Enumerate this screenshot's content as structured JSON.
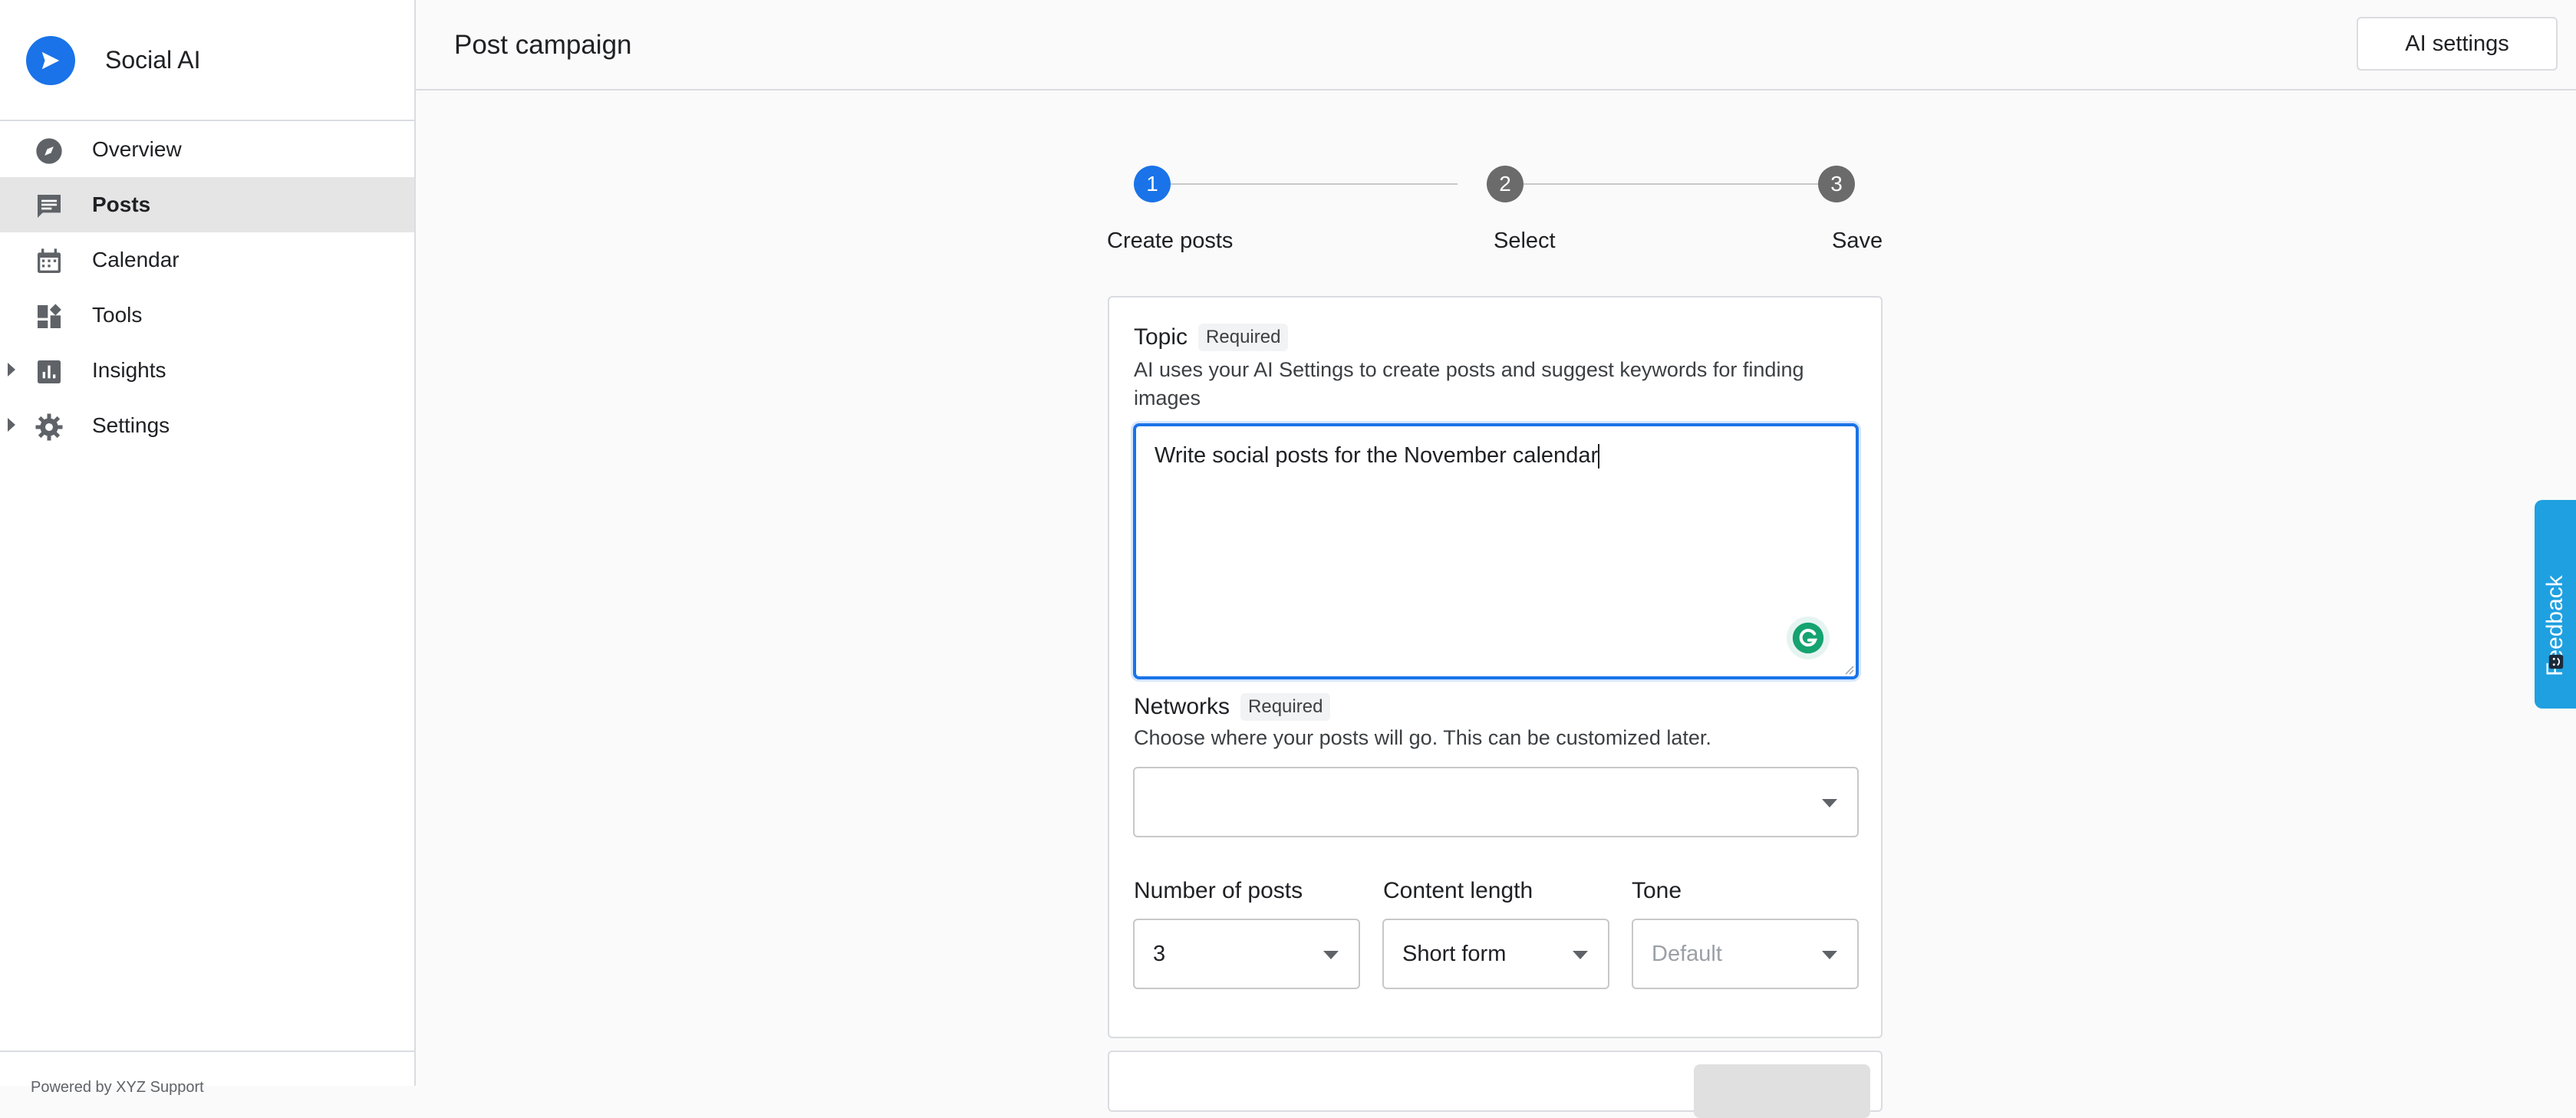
{
  "app": {
    "name": "Social AI",
    "brand_color": "#1a73e8"
  },
  "sidebar": {
    "items": [
      {
        "label": "Overview",
        "icon": "compass-icon",
        "active": false,
        "expandable": false
      },
      {
        "label": "Posts",
        "icon": "chat-icon",
        "active": true,
        "expandable": false
      },
      {
        "label": "Calendar",
        "icon": "calendar-icon",
        "active": false,
        "expandable": false
      },
      {
        "label": "Tools",
        "icon": "dashboard-icon",
        "active": false,
        "expandable": false
      },
      {
        "label": "Insights",
        "icon": "bar-chart-icon",
        "active": false,
        "expandable": true
      },
      {
        "label": "Settings",
        "icon": "gear-icon",
        "active": false,
        "expandable": true
      }
    ],
    "footer": "Powered by XYZ Support"
  },
  "header": {
    "title": "Post campaign",
    "ai_settings_label": "AI settings"
  },
  "stepper": {
    "steps": [
      {
        "number": "1",
        "label": "Create posts",
        "active": true
      },
      {
        "number": "2",
        "label": "Select",
        "active": false
      },
      {
        "number": "3",
        "label": "Save",
        "active": false
      }
    ]
  },
  "form": {
    "topic": {
      "label": "Topic",
      "badge": "Required",
      "help": "AI uses your AI Settings to create posts and suggest keywords for finding images",
      "value": "Write social posts for the November calendar"
    },
    "networks": {
      "label": "Networks",
      "badge": "Required",
      "help": "Choose where your posts will go. This can be customized later.",
      "value": ""
    },
    "number_of_posts": {
      "label": "Number of posts",
      "value": "3"
    },
    "content_length": {
      "label": "Content length",
      "value": "Short form"
    },
    "tone": {
      "label": "Tone",
      "placeholder": "Default"
    }
  },
  "feedback": {
    "label": "Feedback",
    "color": "#1fa0e0"
  }
}
